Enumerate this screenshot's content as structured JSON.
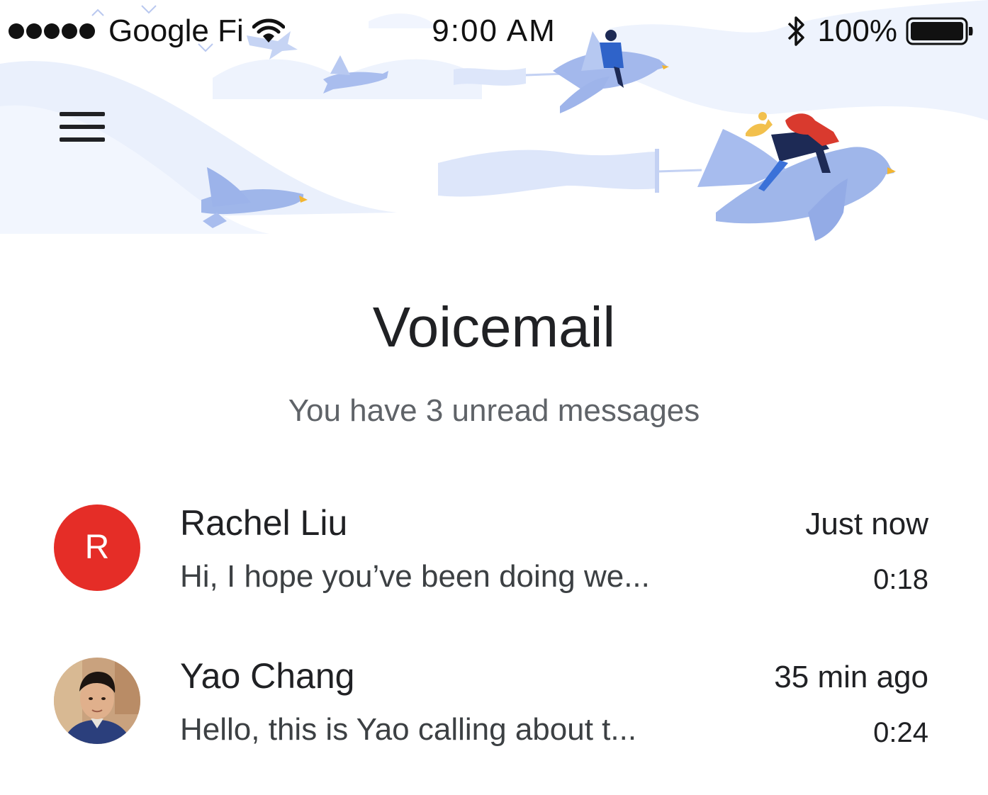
{
  "status_bar": {
    "carrier": "Google Fi",
    "time": "9:00 AM",
    "battery": "100%",
    "signal_icon": "signal-dots-icon",
    "wifi_icon": "wifi-icon",
    "bluetooth_icon": "bluetooth-icon",
    "battery_icon": "battery-icon"
  },
  "header": {
    "menu_icon": "hamburger-menu-icon",
    "illustration": "birds-flying-illustration"
  },
  "page": {
    "title": "Voicemail",
    "subtitle": "You have 3 unread messages"
  },
  "voicemails": [
    {
      "avatar_type": "letter",
      "avatar_letter": "R",
      "avatar_color": "#e52d27",
      "name": "Rachel Liu",
      "preview": "Hi, I hope you’ve been doing we...",
      "time": "Just now",
      "duration": "0:18"
    },
    {
      "avatar_type": "photo",
      "name": "Yao Chang",
      "preview": "Hello, this is Yao calling about t...",
      "time": "35 min ago",
      "duration": "0:24"
    }
  ],
  "colors": {
    "text_primary": "#202124",
    "text_secondary": "#5f6368",
    "illustration_blue": "#9fb6ea",
    "illustration_light": "#dde6fa",
    "accent_red": "#e52d27"
  }
}
